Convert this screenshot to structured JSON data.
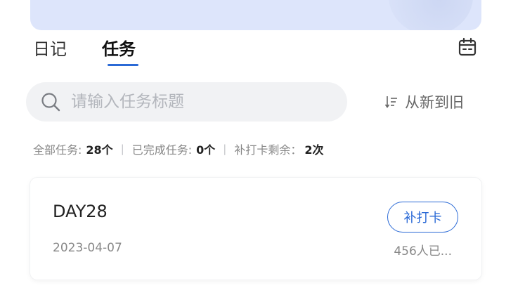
{
  "tabs": [
    {
      "label": "日记",
      "active": false
    },
    {
      "label": "任务",
      "active": true
    }
  ],
  "icons": {
    "calendar": "calendar-icon",
    "search": "search-icon",
    "sort": "sort-icon"
  },
  "search": {
    "placeholder": "请输入任务标题",
    "value": ""
  },
  "sort": {
    "label": "从新到旧"
  },
  "stats": {
    "total_label": "全部任务:",
    "total_value": "28个",
    "completed_label": "已完成任务:",
    "completed_value": "0个",
    "makeup_label": "补打卡剩余：",
    "makeup_value": "2次",
    "separator": "|"
  },
  "task": {
    "title": "DAY28",
    "date": "2023-04-07",
    "button_label": "补打卡",
    "participants": "456人已..."
  },
  "colors": {
    "accent": "#2b6ad6",
    "banner": "#dde5fb",
    "search_bg": "#f1f2f4",
    "muted_text": "#888888"
  }
}
